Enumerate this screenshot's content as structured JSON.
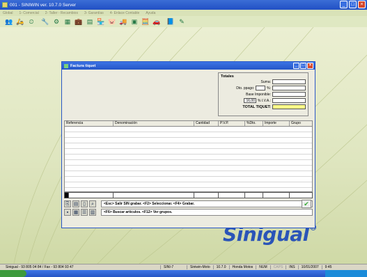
{
  "titlebar": {
    "title": "001 - SINIWIN  ver. 10.7.0 Server"
  },
  "menu": [
    "Global",
    "1- Comercial",
    "2- Taller - Recambios",
    "3- Garantías",
    "4- Enlace Contable",
    "Ayuda"
  ],
  "toolbar_icons": [
    "people-icon",
    "scooter-icon",
    "clock-icon",
    "tools-icon",
    "parts-icon",
    "boxes-icon",
    "briefcase-icon",
    "invoice-icon",
    "store-icon",
    "piggy-icon",
    "truck-icon",
    "display-icon",
    "calculator-icon",
    "car-icon",
    "book-icon",
    "edit-icon"
  ],
  "factura": {
    "title": "Factura tiquet",
    "totals": {
      "heading": "Totales",
      "suma_label": "Suma:",
      "dto_label": "Dto. ppago:",
      "pct_sign": "%:",
      "base_label": "Base Imponible:",
      "iva_pct": "16,00",
      "iva_label": "% I.V.A.:",
      "total_label": "TOTAL TIQUET:"
    },
    "columns": [
      "Referencia",
      "Denominación",
      "Cantidad",
      "P.V.P.",
      "%Dto.",
      "Importe",
      "Grupo"
    ],
    "keys_row1": "<Esc> Salir SIN grabar.   <F2> Seleccionar.   <F4> Grabar.",
    "keys_row2": "<F6> Buscar articulos.   <F12> Ver grupos."
  },
  "logo": {
    "text": "Sinigual",
    "mark": "®"
  },
  "status": {
    "company": "Sinigual - 93 805 04 84 / Fax - 93 804 93 47",
    "user": "SINI-7",
    "module": "Siniwin-Moto",
    "version": "10.7.0",
    "brand": "Honda Motos",
    "num": "NUM",
    "caps": "CAPS",
    "ins": "INS",
    "date": "10/01/2007",
    "time": "9:45"
  },
  "colors": {
    "title_blue": "#2456c8",
    "total_highlight": "#ffff88",
    "logo_blue": "#2a54b8"
  }
}
